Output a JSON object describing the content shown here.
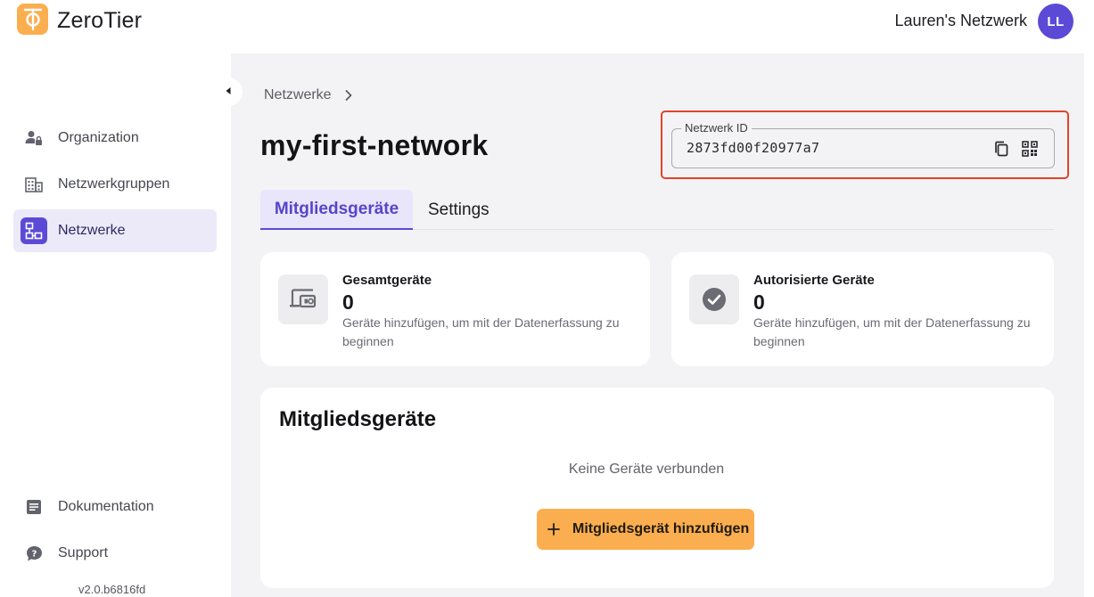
{
  "app": {
    "title": "ZeroTier"
  },
  "account": {
    "name": "Lauren's Netzwerk",
    "initials": "LL"
  },
  "sidebar": {
    "items": [
      {
        "label": "Organization",
        "icon": "person-lock-icon"
      },
      {
        "label": "Netzwerkgruppen",
        "icon": "building-icon"
      },
      {
        "label": "Netzwerke",
        "icon": "network-icon",
        "active": true
      }
    ],
    "bottom_items": [
      {
        "label": "Dokumentation",
        "icon": "document-icon"
      },
      {
        "label": "Support",
        "icon": "chat-question-icon"
      }
    ],
    "version": "v2.0.b6816fd"
  },
  "breadcrumb": {
    "parent": "Netzwerke"
  },
  "network": {
    "name": "my-first-network",
    "id_label": "Netzwerk ID",
    "id_value": "2873fd00f20977a7"
  },
  "tabs": [
    {
      "label": "Mitgliedsgeräte",
      "active": true
    },
    {
      "label": "Settings",
      "active": false
    }
  ],
  "stats": [
    {
      "label": "Gesamtgeräte",
      "value": "0",
      "desc": "Geräte hinzufügen, um mit der Datenerfassung zu beginnen",
      "icon": "devices-icon"
    },
    {
      "label": "Autorisierte Geräte",
      "value": "0",
      "desc": "Geräte hinzufügen, um mit der Datenerfassung zu beginnen",
      "icon": "check-circle-icon"
    }
  ],
  "members": {
    "title": "Mitgliedsgeräte",
    "empty_text": "Keine Geräte verbunden",
    "add_button": "Mitgliedsgerät hinzufügen"
  },
  "colors": {
    "brand_orange": "#fbae4f",
    "accent_purple": "#5b4ad6",
    "highlight_red": "#e0432b"
  }
}
